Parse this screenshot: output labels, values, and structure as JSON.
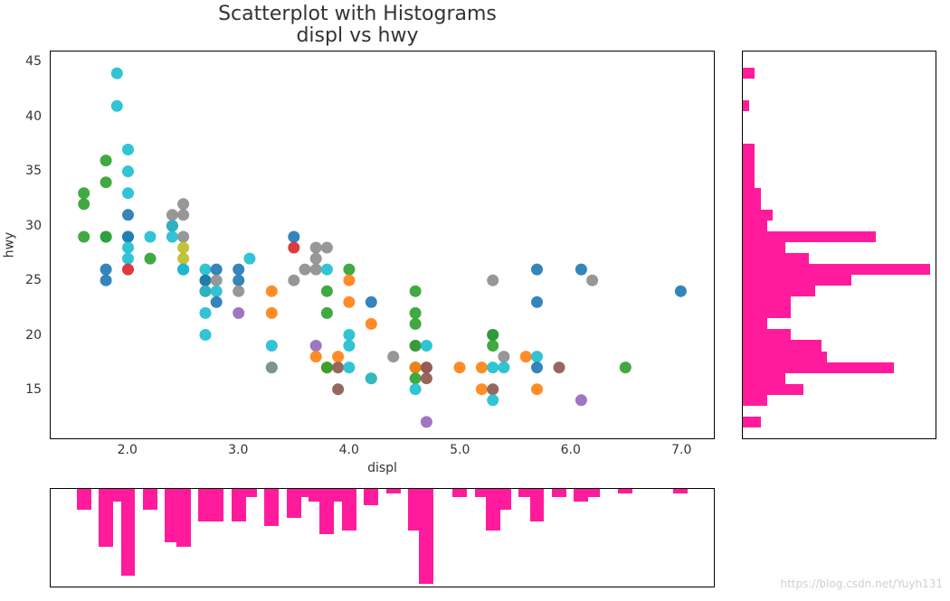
{
  "title": "Scatterplot with Histograms",
  "subtitle": "displ vs hwy",
  "xlabel": "displ",
  "ylabel": "hwy",
  "watermark": "https://blog.csdn.net/Yuyh131",
  "chart_data": {
    "type": "scatter",
    "x_variable": "displ",
    "y_variable": "hwy",
    "xlim": [
      1.3,
      7.3
    ],
    "ylim": [
      10.5,
      46
    ],
    "xticks": [
      2.0,
      3.0,
      4.0,
      5.0,
      6.0,
      7.0
    ],
    "yticks": [
      15,
      20,
      25,
      30,
      35,
      40,
      45
    ],
    "colors": {
      "cyan": "#1bbecf",
      "green": "#2ca02c",
      "blue": "#1f77b4",
      "red": "#d62728",
      "olive": "#bcbd22",
      "grey": "#8c8c8c",
      "orange": "#ff7f0e",
      "purple": "#9467bd",
      "brown": "#8c564b",
      "pink": "#e377c2"
    },
    "points": [
      [
        1.6,
        33,
        "green"
      ],
      [
        1.6,
        32,
        "green"
      ],
      [
        1.6,
        29,
        "green"
      ],
      [
        1.8,
        36,
        "green"
      ],
      [
        1.8,
        34,
        "green"
      ],
      [
        1.8,
        29,
        "cyan"
      ],
      [
        1.8,
        29,
        "green"
      ],
      [
        1.8,
        26,
        "blue"
      ],
      [
        1.8,
        25,
        "blue"
      ],
      [
        1.9,
        44,
        "cyan"
      ],
      [
        1.9,
        41,
        "cyan"
      ],
      [
        2.0,
        37,
        "cyan"
      ],
      [
        2.0,
        35,
        "cyan"
      ],
      [
        2.0,
        33,
        "cyan"
      ],
      [
        2.0,
        31,
        "blue"
      ],
      [
        2.0,
        29,
        "cyan"
      ],
      [
        2.0,
        29,
        "blue"
      ],
      [
        2.0,
        28,
        "cyan"
      ],
      [
        2.0,
        27,
        "cyan"
      ],
      [
        2.0,
        26,
        "red"
      ],
      [
        2.2,
        29,
        "cyan"
      ],
      [
        2.2,
        27,
        "green"
      ],
      [
        2.4,
        31,
        "grey"
      ],
      [
        2.4,
        30,
        "red"
      ],
      [
        2.4,
        30,
        "cyan"
      ],
      [
        2.4,
        29,
        "cyan"
      ],
      [
        2.5,
        32,
        "grey"
      ],
      [
        2.5,
        31,
        "grey"
      ],
      [
        2.5,
        29,
        "grey"
      ],
      [
        2.5,
        28,
        "olive"
      ],
      [
        2.5,
        27,
        "olive"
      ],
      [
        2.5,
        26,
        "olive"
      ],
      [
        2.5,
        26,
        "blue"
      ],
      [
        2.5,
        26,
        "cyan"
      ],
      [
        2.7,
        26,
        "cyan"
      ],
      [
        2.7,
        25,
        "green"
      ],
      [
        2.7,
        25,
        "blue"
      ],
      [
        2.7,
        24,
        "red"
      ],
      [
        2.7,
        24,
        "cyan"
      ],
      [
        2.7,
        22,
        "cyan"
      ],
      [
        2.7,
        20,
        "cyan"
      ],
      [
        2.8,
        26,
        "blue"
      ],
      [
        2.8,
        25,
        "grey"
      ],
      [
        2.8,
        24,
        "cyan"
      ],
      [
        2.8,
        23,
        "blue"
      ],
      [
        3.0,
        26,
        "blue"
      ],
      [
        3.0,
        25,
        "blue"
      ],
      [
        3.0,
        24,
        "grey"
      ],
      [
        3.0,
        22,
        "purple"
      ],
      [
        3.1,
        27,
        "cyan"
      ],
      [
        3.3,
        24,
        "orange"
      ],
      [
        3.3,
        22,
        "orange"
      ],
      [
        3.3,
        19,
        "cyan"
      ],
      [
        3.3,
        17,
        "cyan"
      ],
      [
        3.3,
        17,
        "grey"
      ],
      [
        3.5,
        29,
        "blue"
      ],
      [
        3.5,
        28,
        "red"
      ],
      [
        3.5,
        25,
        "grey"
      ],
      [
        3.6,
        26,
        "grey"
      ],
      [
        3.7,
        28,
        "grey"
      ],
      [
        3.7,
        27,
        "grey"
      ],
      [
        3.7,
        26,
        "grey"
      ],
      [
        3.7,
        19,
        "purple"
      ],
      [
        3.7,
        18,
        "orange"
      ],
      [
        3.8,
        28,
        "grey"
      ],
      [
        3.8,
        26,
        "cyan"
      ],
      [
        3.8,
        24,
        "green"
      ],
      [
        3.8,
        22,
        "green"
      ],
      [
        3.8,
        17,
        "orange"
      ],
      [
        3.8,
        17,
        "green"
      ],
      [
        3.9,
        18,
        "orange"
      ],
      [
        3.9,
        17,
        "brown"
      ],
      [
        3.9,
        15,
        "brown"
      ],
      [
        4.0,
        26,
        "green"
      ],
      [
        4.0,
        25,
        "orange"
      ],
      [
        4.0,
        23,
        "orange"
      ],
      [
        4.0,
        20,
        "cyan"
      ],
      [
        4.0,
        19,
        "cyan"
      ],
      [
        4.0,
        17,
        "cyan"
      ],
      [
        4.2,
        23,
        "blue"
      ],
      [
        4.2,
        21,
        "orange"
      ],
      [
        4.2,
        16,
        "orange"
      ],
      [
        4.2,
        16,
        "cyan"
      ],
      [
        4.4,
        18,
        "grey"
      ],
      [
        4.6,
        24,
        "green"
      ],
      [
        4.6,
        22,
        "green"
      ],
      [
        4.6,
        21,
        "green"
      ],
      [
        4.6,
        19,
        "purple"
      ],
      [
        4.6,
        19,
        "green"
      ],
      [
        4.6,
        17,
        "green"
      ],
      [
        4.6,
        17,
        "orange"
      ],
      [
        4.6,
        16,
        "green"
      ],
      [
        4.6,
        15,
        "cyan"
      ],
      [
        4.7,
        12,
        "purple"
      ],
      [
        4.7,
        19,
        "cyan"
      ],
      [
        4.7,
        17,
        "pink"
      ],
      [
        4.7,
        17,
        "brown"
      ],
      [
        4.7,
        16,
        "brown"
      ],
      [
        5.0,
        17,
        "orange"
      ],
      [
        5.2,
        17,
        "orange"
      ],
      [
        5.2,
        15,
        "orange"
      ],
      [
        5.3,
        25,
        "grey"
      ],
      [
        5.3,
        20,
        "blue"
      ],
      [
        5.3,
        20,
        "green"
      ],
      [
        5.3,
        19,
        "green"
      ],
      [
        5.3,
        17,
        "cyan"
      ],
      [
        5.3,
        15,
        "brown"
      ],
      [
        5.3,
        14,
        "cyan"
      ],
      [
        5.4,
        18,
        "grey"
      ],
      [
        5.4,
        17,
        "cyan"
      ],
      [
        5.6,
        18,
        "orange"
      ],
      [
        5.7,
        26,
        "blue"
      ],
      [
        5.7,
        23,
        "blue"
      ],
      [
        5.7,
        18,
        "cyan"
      ],
      [
        5.7,
        17,
        "blue"
      ],
      [
        5.7,
        15,
        "orange"
      ],
      [
        5.9,
        17,
        "brown"
      ],
      [
        6.1,
        26,
        "blue"
      ],
      [
        6.1,
        14,
        "purple"
      ],
      [
        6.2,
        25,
        "grey"
      ],
      [
        6.5,
        17,
        "green"
      ],
      [
        7.0,
        24,
        "blue"
      ]
    ],
    "histogram_displ": {
      "type": "bar",
      "orientation": "vertical-downward",
      "color": "#ff1b9c",
      "bin_width": 0.13,
      "bins": [
        [
          1.6,
          5
        ],
        [
          1.8,
          14
        ],
        [
          1.9,
          3
        ],
        [
          2.0,
          21
        ],
        [
          2.2,
          5
        ],
        [
          2.4,
          13
        ],
        [
          2.5,
          14
        ],
        [
          2.7,
          8
        ],
        [
          2.8,
          8
        ],
        [
          3.0,
          8
        ],
        [
          3.1,
          2
        ],
        [
          3.3,
          9
        ],
        [
          3.5,
          7
        ],
        [
          3.6,
          2
        ],
        [
          3.7,
          3
        ],
        [
          3.8,
          11
        ],
        [
          3.9,
          3
        ],
        [
          4.0,
          10
        ],
        [
          4.2,
          4
        ],
        [
          4.4,
          1
        ],
        [
          4.6,
          10
        ],
        [
          4.7,
          23
        ],
        [
          5.0,
          2
        ],
        [
          5.2,
          2
        ],
        [
          5.3,
          10
        ],
        [
          5.4,
          5
        ],
        [
          5.6,
          2
        ],
        [
          5.7,
          8
        ],
        [
          5.9,
          2
        ],
        [
          6.1,
          3
        ],
        [
          6.2,
          2
        ],
        [
          6.5,
          1
        ],
        [
          7.0,
          1
        ]
      ]
    },
    "histogram_hwy": {
      "type": "bar",
      "orientation": "horizontal",
      "color": "#ff1b9c",
      "bin_width": 1,
      "bins": [
        [
          12,
          3
        ],
        [
          14,
          4
        ],
        [
          15,
          10
        ],
        [
          16,
          7
        ],
        [
          17,
          25
        ],
        [
          18,
          14
        ],
        [
          19,
          13
        ],
        [
          20,
          8
        ],
        [
          21,
          4
        ],
        [
          22,
          8
        ],
        [
          23,
          8
        ],
        [
          24,
          12
        ],
        [
          25,
          18
        ],
        [
          26,
          31
        ],
        [
          27,
          11
        ],
        [
          28,
          7
        ],
        [
          29,
          22
        ],
        [
          30,
          4
        ],
        [
          31,
          5
        ],
        [
          32,
          3
        ],
        [
          33,
          3
        ],
        [
          34,
          2
        ],
        [
          35,
          2
        ],
        [
          36,
          2
        ],
        [
          37,
          2
        ],
        [
          41,
          1
        ],
        [
          44,
          2
        ]
      ]
    }
  }
}
